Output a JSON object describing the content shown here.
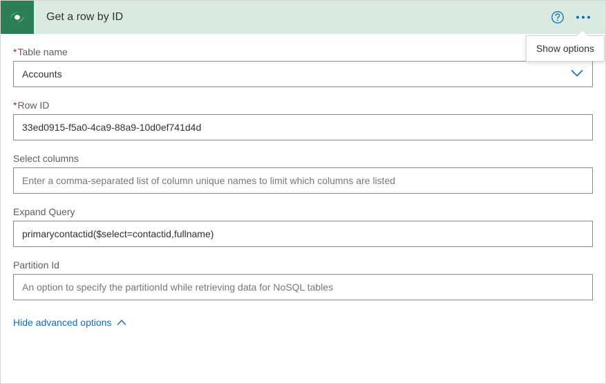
{
  "header": {
    "title": "Get a row by ID",
    "tooltip": "Show options"
  },
  "fields": {
    "table_name": {
      "label": "Table name",
      "value": "Accounts"
    },
    "row_id": {
      "label": "Row ID",
      "value": "33ed0915-f5a0-4ca9-88a9-10d0ef741d4d"
    },
    "select_columns": {
      "label": "Select columns",
      "placeholder": "Enter a comma-separated list of column unique names to limit which columns are listed"
    },
    "expand_query": {
      "label": "Expand Query",
      "value": "primarycontactid($select=contactid,fullname)"
    },
    "partition_id": {
      "label": "Partition Id",
      "placeholder": "An option to specify the partitionId while retrieving data for NoSQL tables"
    }
  },
  "advanced_toggle": "Hide advanced options"
}
